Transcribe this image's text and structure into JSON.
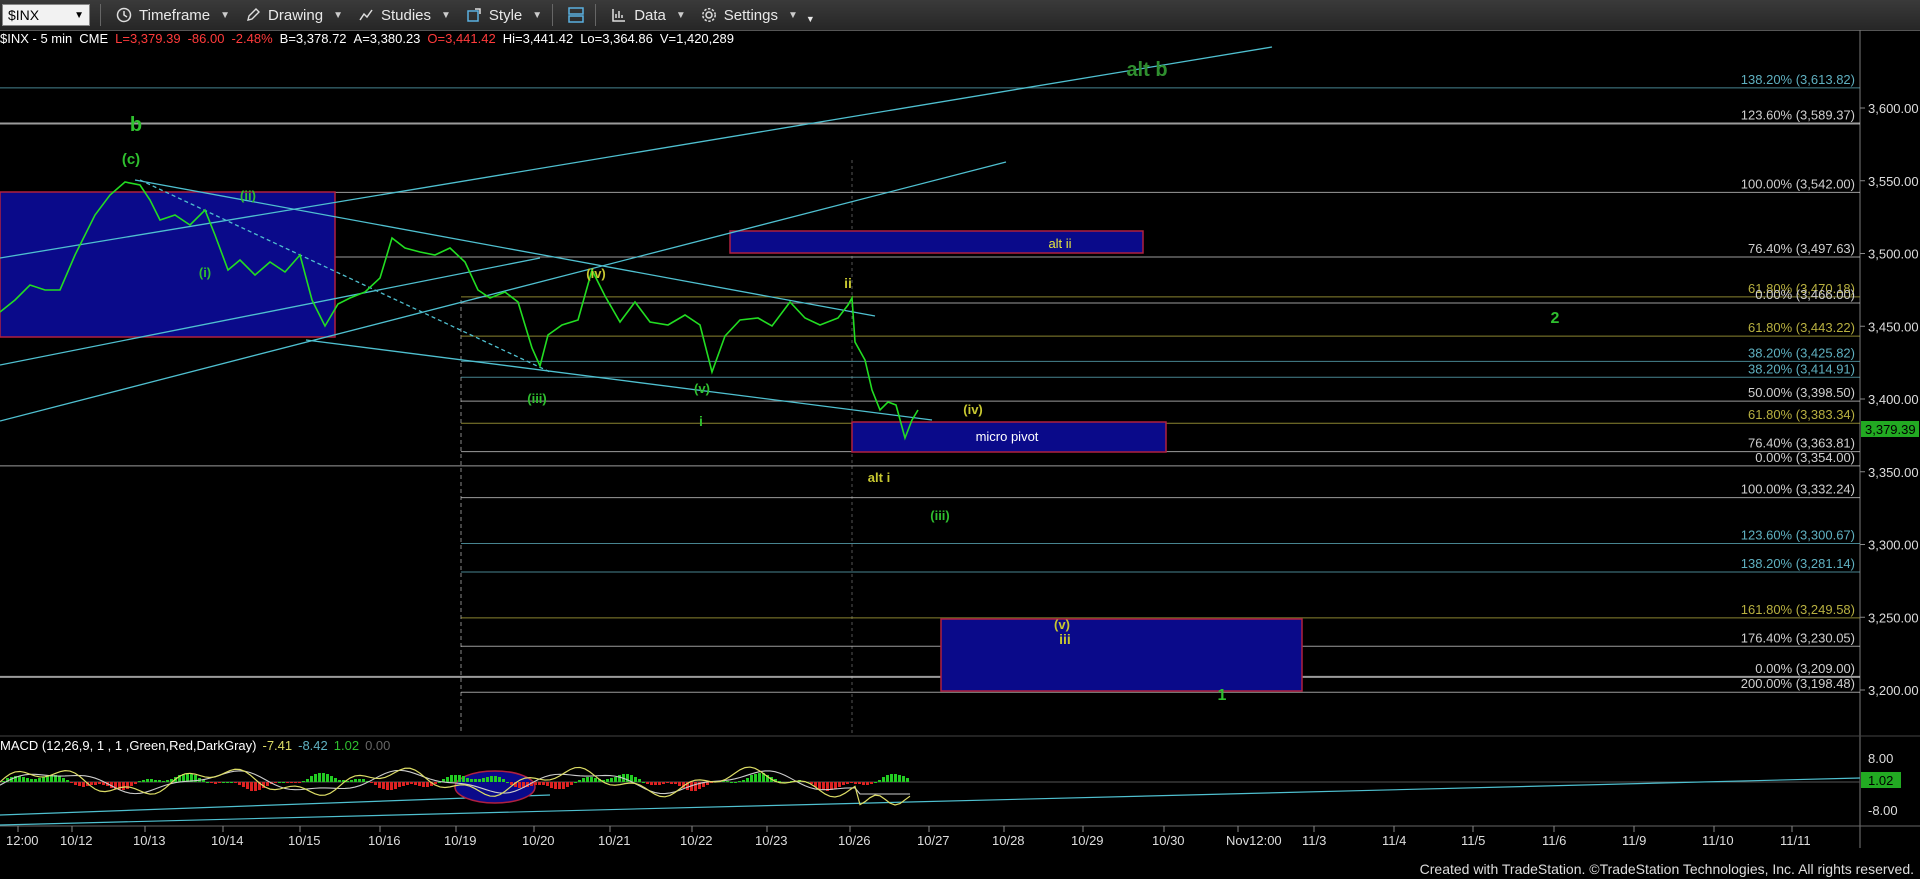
{
  "toolbar": {
    "symbol": "$INX",
    "timeframe": "Timeframe",
    "drawing": "Drawing",
    "studies": "Studies",
    "style": "Style",
    "data": "Data",
    "settings": "Settings"
  },
  "info": {
    "symbol": "$INX - 5 min",
    "exchange": "CME",
    "last": "L=3,379.39",
    "change": "-86.00",
    "pct": "-2.48%",
    "bid": "B=3,378.72",
    "ask": "A=3,380.23",
    "open": "O=3,441.42",
    "high": "Hi=3,441.42",
    "low": "Lo=3,364.86",
    "volume": "V=1,420,289"
  },
  "macd": {
    "name": "MACD (12,26,9, 1 , 1 ,Green,Red,DarkGray)",
    "v1": "-7.41",
    "v2": "-8.42",
    "v3": "1.02",
    "v4": "0.00"
  },
  "price_axis": [
    "3,600.00",
    "3,550.00",
    "3,500.00",
    "3,450.00",
    "3,400.00",
    "3,350.00",
    "3,300.00",
    "3,250.00",
    "3,200.00"
  ],
  "current_price": "3,379.39",
  "macd_axis": [
    "8.00",
    "1.02",
    "-8.00"
  ],
  "time_axis": [
    "12:00",
    "10/12",
    "10/13",
    "10/14",
    "10/15",
    "10/16",
    "10/19",
    "10/20",
    "10/21",
    "10/22",
    "10/23",
    "10/26",
    "10/27",
    "10/28",
    "10/29",
    "10/30",
    "Nov12:00",
    "11/3",
    "11/4",
    "11/5",
    "11/6",
    "11/9",
    "11/10",
    "11/11"
  ],
  "fib_labels": [
    {
      "text": "138.20% (3,613.82)",
      "color": "#5fb0c0",
      "price": 3613.82
    },
    {
      "text": "123.60% (3,589.37)",
      "color": "#cfcfcf",
      "price": 3589.37
    },
    {
      "text": "100.00% (3,542.00)",
      "color": "#cfcfcf",
      "price": 3542.0
    },
    {
      "text": "76.40% (3,497.63)",
      "color": "#cfcfcf",
      "price": 3497.63
    },
    {
      "text": "61.80% (3,470.18)",
      "color": "#b8b040",
      "price": 3470.18
    },
    {
      "text": "0.00% (3,466.00)",
      "color": "#cfcfcf",
      "price": 3466.0
    },
    {
      "text": "61.80% (3,443.22)",
      "color": "#b8b040",
      "price": 3443.22
    },
    {
      "text": "38.20% (3,425.82)",
      "color": "#5fb0c0",
      "price": 3425.82
    },
    {
      "text": "38.20% (3,414.91)",
      "color": "#5fb0c0",
      "price": 3414.91
    },
    {
      "text": "50.00% (3,398.50)",
      "color": "#cfcfcf",
      "price": 3398.5
    },
    {
      "text": "61.80% (3,383.34)",
      "color": "#b8b040",
      "price": 3383.34
    },
    {
      "text": "76.40% (3,363.81)",
      "color": "#cfcfcf",
      "price": 3363.81
    },
    {
      "text": "0.00% (3,354.00)",
      "color": "#cfcfcf",
      "price": 3354.0
    },
    {
      "text": "100.00% (3,332.24)",
      "color": "#cfcfcf",
      "price": 3332.24
    },
    {
      "text": "123.60% (3,300.67)",
      "color": "#5fb0c0",
      "price": 3300.67
    },
    {
      "text": "138.20% (3,281.14)",
      "color": "#5fb0c0",
      "price": 3281.14
    },
    {
      "text": "161.80% (3,249.58)",
      "color": "#b8b040",
      "price": 3249.58
    },
    {
      "text": "176.40% (3,230.05)",
      "color": "#cfcfcf",
      "price": 3230.05
    },
    {
      "text": "0.00% (3,209.00)",
      "color": "#cfcfcf",
      "price": 3209.0
    },
    {
      "text": "200.00% (3,198.48)",
      "color": "#cfcfcf",
      "price": 3198.48
    }
  ],
  "wave_labels": [
    {
      "text": "b",
      "color": "#2fbf2f"
    },
    {
      "text": "(c)",
      "color": "#2fbf2f"
    },
    {
      "text": "(ii)",
      "color": "#2fbf2f"
    },
    {
      "text": "(i)",
      "color": "#2fbf2f"
    },
    {
      "text": "(iv)",
      "color": "#c8c830"
    },
    {
      "text": "(iii)",
      "color": "#2fbf2f"
    },
    {
      "text": "(v)",
      "color": "#2fbf2f"
    },
    {
      "text": "i",
      "color": "#2fbf2f"
    },
    {
      "text": "ii",
      "color": "#c8c830"
    },
    {
      "text": "alt i",
      "color": "#c8c830"
    },
    {
      "text": "(iv)",
      "color": "#c8c830"
    },
    {
      "text": "(iii)",
      "color": "#2fbf2f"
    },
    {
      "text": "(v)",
      "color": "#c8c830"
    },
    {
      "text": "iii",
      "color": "#c8c830"
    },
    {
      "text": "1",
      "color": "#2fbf2f"
    },
    {
      "text": "2",
      "color": "#2fbf2f"
    },
    {
      "text": "alt b",
      "color": "#2f8f2f"
    }
  ],
  "boxes": {
    "alt_ii": "alt ii",
    "micro_pivot": "micro pivot"
  },
  "footer": "Created with TradeStation. ©TradeStation Technologies, Inc. All rights reserved.",
  "colors": {
    "price": "#22dd22",
    "channel": "#4fc0d0",
    "box_fill": "#0a0a8a",
    "box_border": "#b02040",
    "macd_line": "#dddd66",
    "macd_signal": "#cccccc"
  }
}
